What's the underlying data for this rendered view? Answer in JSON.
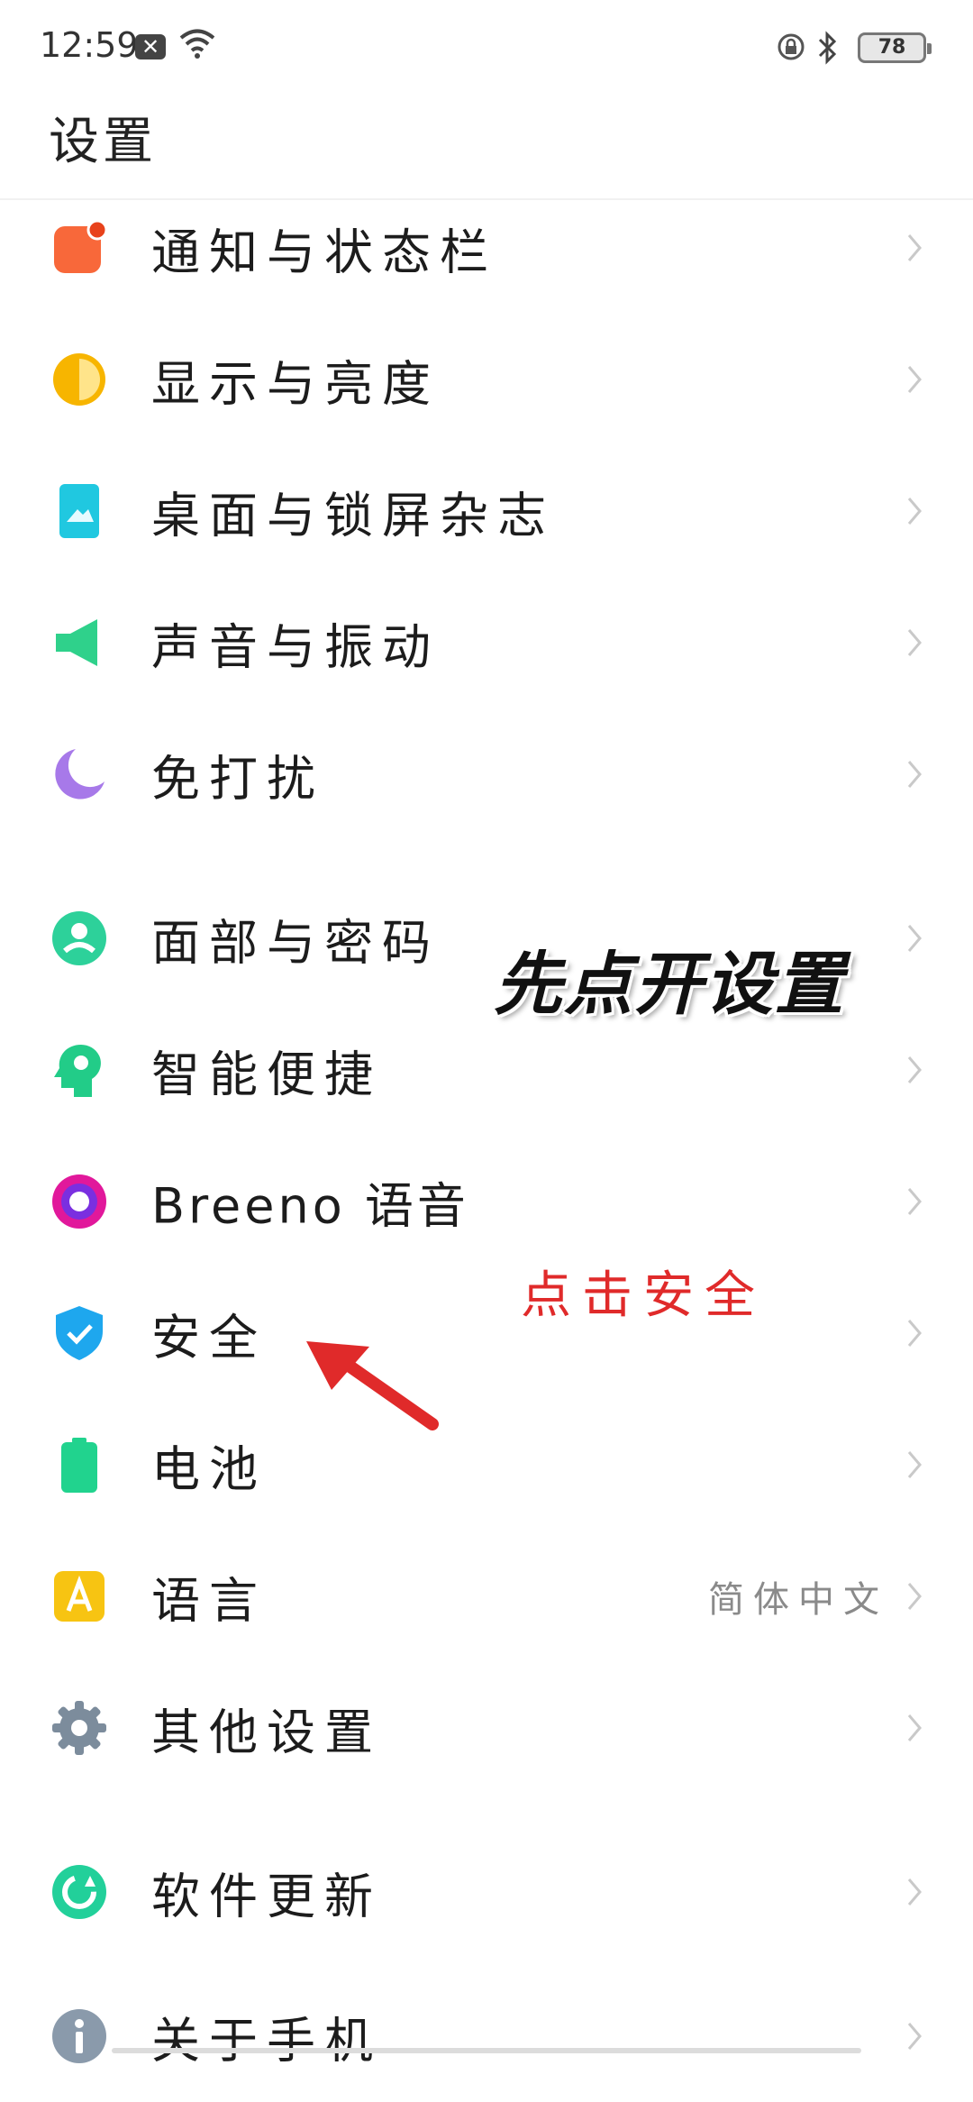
{
  "status_bar": {
    "time": "12:59",
    "battery": "78"
  },
  "header": {
    "title": "设置"
  },
  "settings": [
    {
      "label": "通知与状态栏",
      "icon": "notification-icon"
    },
    {
      "label": "显示与亮度",
      "icon": "brightness-icon"
    },
    {
      "label": "桌面与锁屏杂志",
      "icon": "wallpaper-icon"
    },
    {
      "label": "声音与振动",
      "icon": "speaker-icon"
    },
    {
      "label": "免打扰",
      "icon": "moon-icon"
    },
    {
      "label": "面部与密码",
      "icon": "face-icon"
    },
    {
      "label": "智能便捷",
      "icon": "smart-head-icon"
    },
    {
      "label": "Breeno 语音",
      "icon": "breeno-icon"
    },
    {
      "label": "安全",
      "icon": "shield-icon"
    },
    {
      "label": "电池",
      "icon": "battery-icon"
    },
    {
      "label": "语言",
      "icon": "language-icon",
      "value": "简体中文"
    },
    {
      "label": "其他设置",
      "icon": "gear-icon"
    },
    {
      "label": "软件更新",
      "icon": "update-icon"
    },
    {
      "label": "关于手机",
      "icon": "info-icon"
    }
  ],
  "overlay": {
    "title": "先点开设置",
    "hint": "点击安全"
  },
  "colors": {
    "accent_red": "#e02a2a"
  }
}
